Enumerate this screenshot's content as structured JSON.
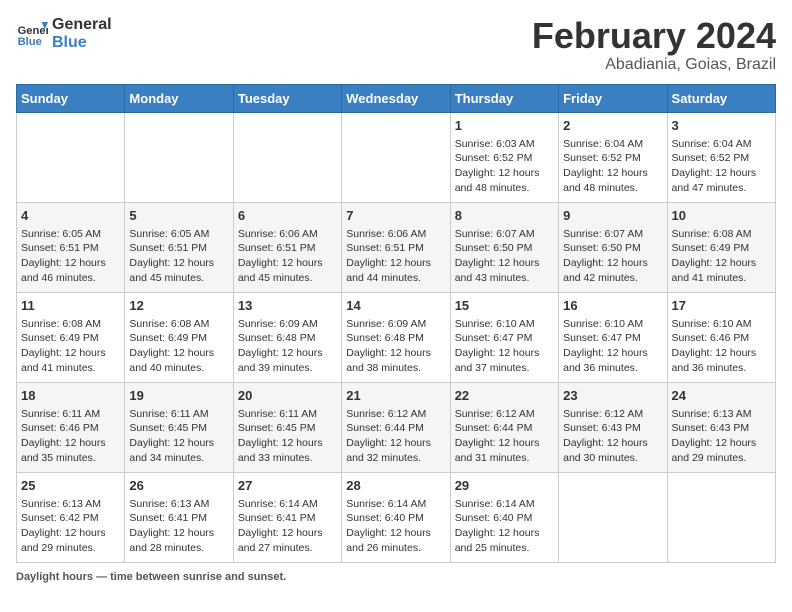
{
  "logo": {
    "line1": "General",
    "line2": "Blue"
  },
  "title": "February 2024",
  "subtitle": "Abadiania, Goias, Brazil",
  "days_of_week": [
    "Sunday",
    "Monday",
    "Tuesday",
    "Wednesday",
    "Thursday",
    "Friday",
    "Saturday"
  ],
  "weeks": [
    [
      {
        "day": "",
        "info": ""
      },
      {
        "day": "",
        "info": ""
      },
      {
        "day": "",
        "info": ""
      },
      {
        "day": "",
        "info": ""
      },
      {
        "day": "1",
        "info": "Sunrise: 6:03 AM\nSunset: 6:52 PM\nDaylight: 12 hours and 48 minutes."
      },
      {
        "day": "2",
        "info": "Sunrise: 6:04 AM\nSunset: 6:52 PM\nDaylight: 12 hours and 48 minutes."
      },
      {
        "day": "3",
        "info": "Sunrise: 6:04 AM\nSunset: 6:52 PM\nDaylight: 12 hours and 47 minutes."
      }
    ],
    [
      {
        "day": "4",
        "info": "Sunrise: 6:05 AM\nSunset: 6:51 PM\nDaylight: 12 hours and 46 minutes."
      },
      {
        "day": "5",
        "info": "Sunrise: 6:05 AM\nSunset: 6:51 PM\nDaylight: 12 hours and 45 minutes."
      },
      {
        "day": "6",
        "info": "Sunrise: 6:06 AM\nSunset: 6:51 PM\nDaylight: 12 hours and 45 minutes."
      },
      {
        "day": "7",
        "info": "Sunrise: 6:06 AM\nSunset: 6:51 PM\nDaylight: 12 hours and 44 minutes."
      },
      {
        "day": "8",
        "info": "Sunrise: 6:07 AM\nSunset: 6:50 PM\nDaylight: 12 hours and 43 minutes."
      },
      {
        "day": "9",
        "info": "Sunrise: 6:07 AM\nSunset: 6:50 PM\nDaylight: 12 hours and 42 minutes."
      },
      {
        "day": "10",
        "info": "Sunrise: 6:08 AM\nSunset: 6:49 PM\nDaylight: 12 hours and 41 minutes."
      }
    ],
    [
      {
        "day": "11",
        "info": "Sunrise: 6:08 AM\nSunset: 6:49 PM\nDaylight: 12 hours and 41 minutes."
      },
      {
        "day": "12",
        "info": "Sunrise: 6:08 AM\nSunset: 6:49 PM\nDaylight: 12 hours and 40 minutes."
      },
      {
        "day": "13",
        "info": "Sunrise: 6:09 AM\nSunset: 6:48 PM\nDaylight: 12 hours and 39 minutes."
      },
      {
        "day": "14",
        "info": "Sunrise: 6:09 AM\nSunset: 6:48 PM\nDaylight: 12 hours and 38 minutes."
      },
      {
        "day": "15",
        "info": "Sunrise: 6:10 AM\nSunset: 6:47 PM\nDaylight: 12 hours and 37 minutes."
      },
      {
        "day": "16",
        "info": "Sunrise: 6:10 AM\nSunset: 6:47 PM\nDaylight: 12 hours and 36 minutes."
      },
      {
        "day": "17",
        "info": "Sunrise: 6:10 AM\nSunset: 6:46 PM\nDaylight: 12 hours and 36 minutes."
      }
    ],
    [
      {
        "day": "18",
        "info": "Sunrise: 6:11 AM\nSunset: 6:46 PM\nDaylight: 12 hours and 35 minutes."
      },
      {
        "day": "19",
        "info": "Sunrise: 6:11 AM\nSunset: 6:45 PM\nDaylight: 12 hours and 34 minutes."
      },
      {
        "day": "20",
        "info": "Sunrise: 6:11 AM\nSunset: 6:45 PM\nDaylight: 12 hours and 33 minutes."
      },
      {
        "day": "21",
        "info": "Sunrise: 6:12 AM\nSunset: 6:44 PM\nDaylight: 12 hours and 32 minutes."
      },
      {
        "day": "22",
        "info": "Sunrise: 6:12 AM\nSunset: 6:44 PM\nDaylight: 12 hours and 31 minutes."
      },
      {
        "day": "23",
        "info": "Sunrise: 6:12 AM\nSunset: 6:43 PM\nDaylight: 12 hours and 30 minutes."
      },
      {
        "day": "24",
        "info": "Sunrise: 6:13 AM\nSunset: 6:43 PM\nDaylight: 12 hours and 29 minutes."
      }
    ],
    [
      {
        "day": "25",
        "info": "Sunrise: 6:13 AM\nSunset: 6:42 PM\nDaylight: 12 hours and 29 minutes."
      },
      {
        "day": "26",
        "info": "Sunrise: 6:13 AM\nSunset: 6:41 PM\nDaylight: 12 hours and 28 minutes."
      },
      {
        "day": "27",
        "info": "Sunrise: 6:14 AM\nSunset: 6:41 PM\nDaylight: 12 hours and 27 minutes."
      },
      {
        "day": "28",
        "info": "Sunrise: 6:14 AM\nSunset: 6:40 PM\nDaylight: 12 hours and 26 minutes."
      },
      {
        "day": "29",
        "info": "Sunrise: 6:14 AM\nSunset: 6:40 PM\nDaylight: 12 hours and 25 minutes."
      },
      {
        "day": "",
        "info": ""
      },
      {
        "day": "",
        "info": ""
      }
    ]
  ],
  "footer": {
    "label": "Daylight hours",
    "text": " — time between sunrise and sunset."
  }
}
